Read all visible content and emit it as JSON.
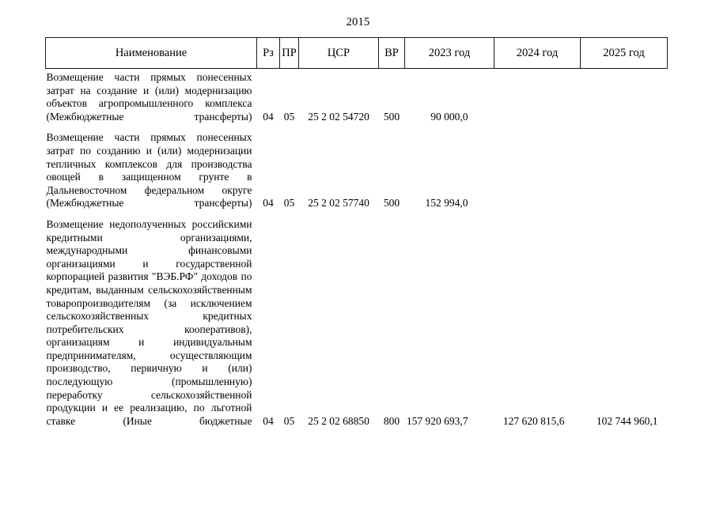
{
  "document": {
    "page_number": "2015"
  },
  "table": {
    "headers": [
      {
        "key": "name",
        "label": "Наименование"
      },
      {
        "key": "rz",
        "label": "Рз"
      },
      {
        "key": "pr",
        "label": "ПР"
      },
      {
        "key": "csr",
        "label": "ЦСР"
      },
      {
        "key": "vr",
        "label": "ВР"
      },
      {
        "key": "y2023",
        "label": "2023 год"
      },
      {
        "key": "y2024",
        "label": "2024 год"
      },
      {
        "key": "y2025",
        "label": "2025 год"
      }
    ],
    "rows": [
      {
        "name": "Возмещение части прямых понесенных затрат на создание и (или) модернизацию объектов агропромышленного комплекса (Межбюджетные трансферты)",
        "rz": "04",
        "pr": "05",
        "csr": "25 2 02 54720",
        "vr": "500",
        "y2023": "90 000,0",
        "y2024": "",
        "y2025": ""
      },
      {
        "name": "Возмещение части прямых понесенных затрат по созданию и (или) модернизации тепличных комплексов для производства овощей в защищенном грунте в Дальневосточном федеральном округе (Межбюджетные трансферты)",
        "rz": "04",
        "pr": "05",
        "csr": "25 2 02 57740",
        "vr": "500",
        "y2023": "152 994,0",
        "y2024": "",
        "y2025": ""
      },
      {
        "name": "Возмещение недополученных российскими кредитными организациями, международными финансовыми организациями и государственной корпорацией развития \"ВЭБ.РФ\" доходов по кредитам, выданным сельскохозяйственным товаропроизводителям (за исключением сельскохозяйственных кредитных потребительских кооперативов), организациям и индивидуальным предпринимателям, осуществляющим производство, первичную и (или) последующую (промышленную) переработку сельскохозяйственной продукции и ее реализацию, по льготной ставке (Иные бюджетные",
        "rz": "04",
        "pr": "05",
        "csr": "25 2 02 68850",
        "vr": "800",
        "y2023": "157 920 693,7",
        "y2024": "127 620 815,6",
        "y2025": "102 744 960,1"
      }
    ]
  }
}
